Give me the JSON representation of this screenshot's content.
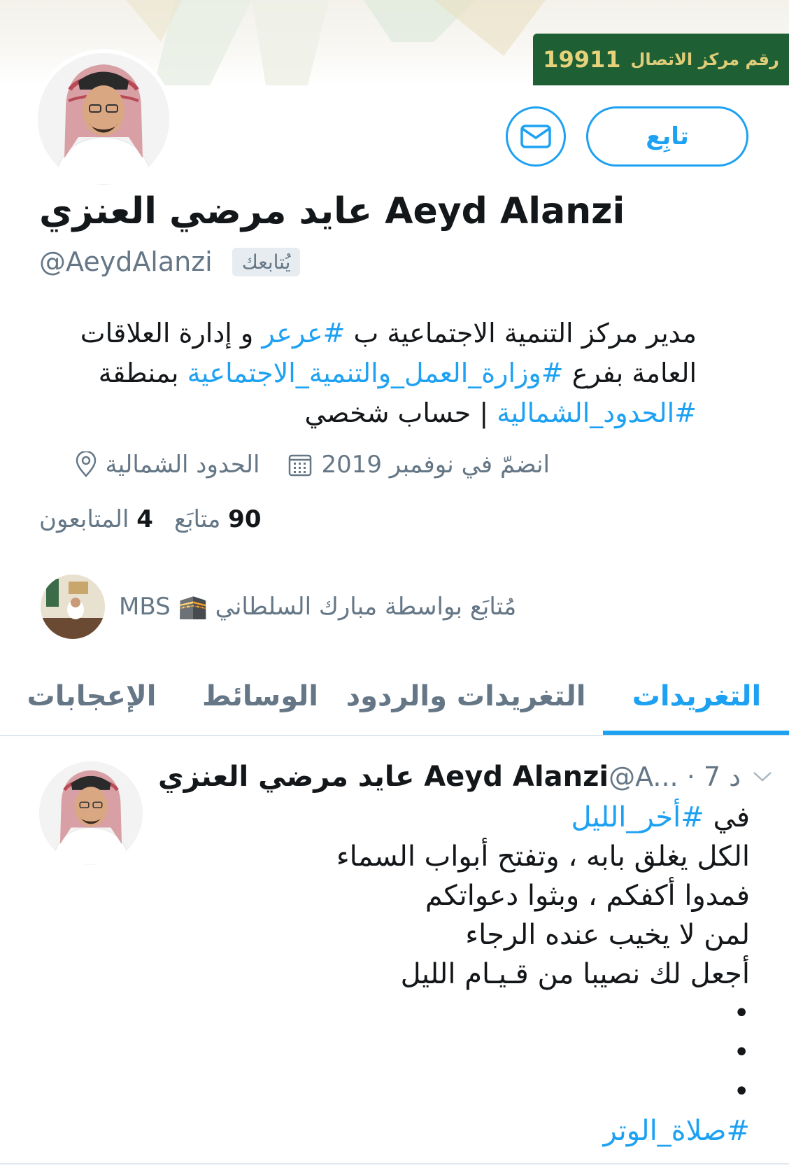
{
  "banner": {
    "hotline_label": "رقم مركز الاتصال",
    "hotline_number": "19911",
    "accent_color": "#1e5f33",
    "text_color": "#d9c26a"
  },
  "profile": {
    "follow_label": "تابِع",
    "message_icon": "envelope-icon",
    "display_name": "عايد مرضي العنزي Aeyd Alanzi",
    "handle": "@AeydAlanzi",
    "follows_you": "يُتابعك",
    "bio": {
      "line1_a": "مدير مركز التنمية الاجتماعية ب ",
      "line1_tag": "#عرعر",
      "line1_b": " و إدارة العلاقات",
      "line2_a": "العامة بفرع ",
      "line2_tag": "#وزارة_العمل_والتنمية_الاجتماعية",
      "line2_b": " بمنطقة",
      "line3_tag": "#الحدود_الشمالية",
      "line3_b": " | حساب شخصي"
    },
    "joined": "انضمّ في نوفمبر 2019",
    "location": "الحدود الشمالية",
    "following_count": "90",
    "following_label": "متابَع",
    "followers_count": "4",
    "followers_label": "المتابعون",
    "followed_by": "مُتابَع بواسطة مبارك السلطاني 🕋 MBS"
  },
  "tabs": {
    "tweets": "التغريدات",
    "tweets_replies": "التغريدات والردود",
    "media": "الوسائط",
    "likes": "الإعجابات"
  },
  "tweet": {
    "author": "عايد مرضي العنزي Aeyd Alanzi",
    "handle_time": "@A... · 7 د",
    "line1_a": "في ",
    "line1_tag": "#أخر_الليل",
    "line2": "الكل يغلق بابه ، وتفتح أبواب السماء",
    "line3": "فمدوا أكفكم ، وبثوا دعواتكم",
    "line4": "لمن لا يخيب عنده الرجاء",
    "line5": "أجعل لك نصيبا من قـيـام الليل",
    "dot": "•",
    "closing_tag": "#صلاة_الوتر"
  },
  "colors": {
    "link": "#1da1f2",
    "secondary_text": "#657786",
    "primary_text": "#14171a"
  }
}
